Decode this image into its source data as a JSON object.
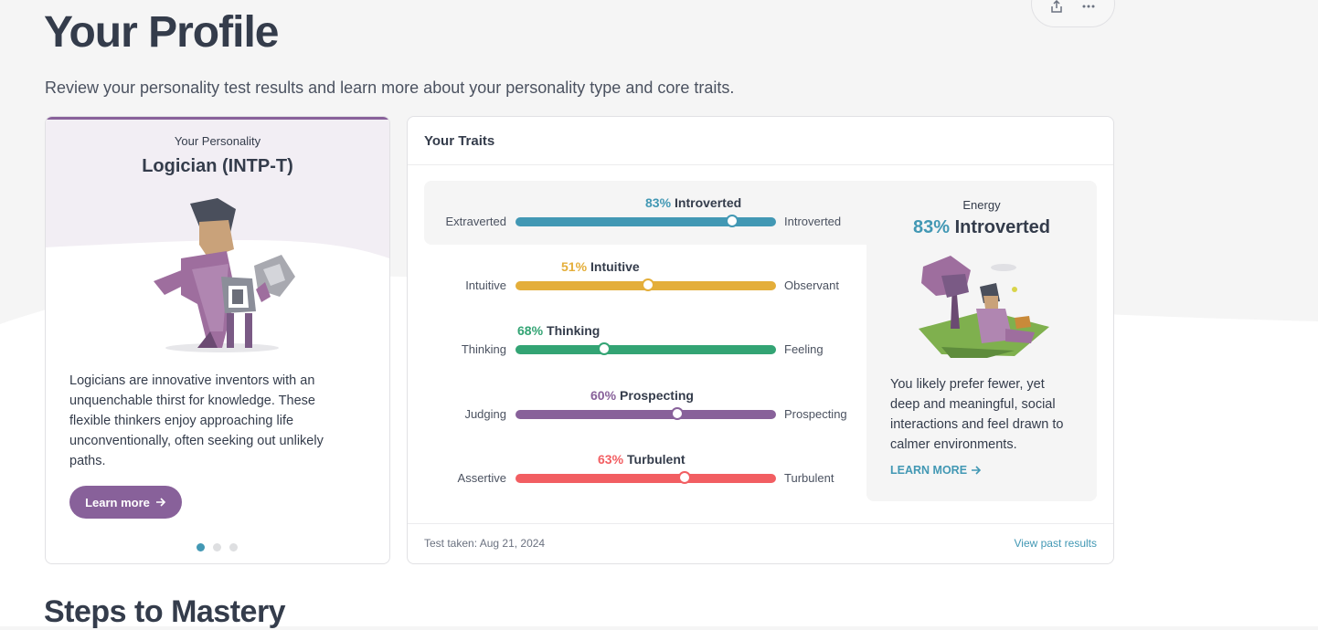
{
  "header": {
    "title": "Your Profile",
    "subtitle": "Review your personality test results and learn more about your personality type and core traits."
  },
  "personality_card": {
    "label": "Your Personality",
    "type": "Logician (INTP-T)",
    "description": "Logicians are innovative inventors with an unquenchable thirst for knowledge. These flexible thinkers enjoy approaching life unconventionally, often seeking out unlikely paths.",
    "button_label": "Learn more",
    "carousel_active_index": 0,
    "carousel_count": 3,
    "accent_color": "#88619a"
  },
  "traits_card": {
    "title": "Your Traits",
    "traits": [
      {
        "percent_text": "83%",
        "name": "Introverted",
        "left_label": "Extraverted",
        "right_label": "Introverted",
        "position": 0.83,
        "color": "#4298b4"
      },
      {
        "percent_text": "51%",
        "name": "Intuitive",
        "left_label": "Intuitive",
        "right_label": "Observant",
        "position": 0.51,
        "color": "#e4ae3a"
      },
      {
        "percent_text": "68%",
        "name": "Thinking",
        "left_label": "Thinking",
        "right_label": "Feeling",
        "position": 0.34,
        "color": "#33a474"
      },
      {
        "percent_text": "60%",
        "name": "Prospecting",
        "left_label": "Judging",
        "right_label": "Prospecting",
        "position": 0.62,
        "color": "#88619a"
      },
      {
        "percent_text": "63%",
        "name": "Turbulent",
        "left_label": "Assertive",
        "right_label": "Turbulent",
        "position": 0.65,
        "color": "#f25e62"
      }
    ],
    "selected_index": 0,
    "energy": {
      "label": "Energy",
      "percent_text": "83%",
      "value_text": "Introverted",
      "description": "You likely prefer fewer, yet deep and meaningful, social interactions and feel drawn to calmer environments.",
      "link_label": "LEARN MORE"
    },
    "footer": {
      "test_taken": "Test taken: Aug 21, 2024",
      "past_results": "View past results"
    }
  },
  "steps": {
    "title": "Steps to Mastery"
  },
  "icons": {
    "share": "share-icon",
    "more": "more-dots-icon",
    "arrow": "arrow-right-icon"
  }
}
